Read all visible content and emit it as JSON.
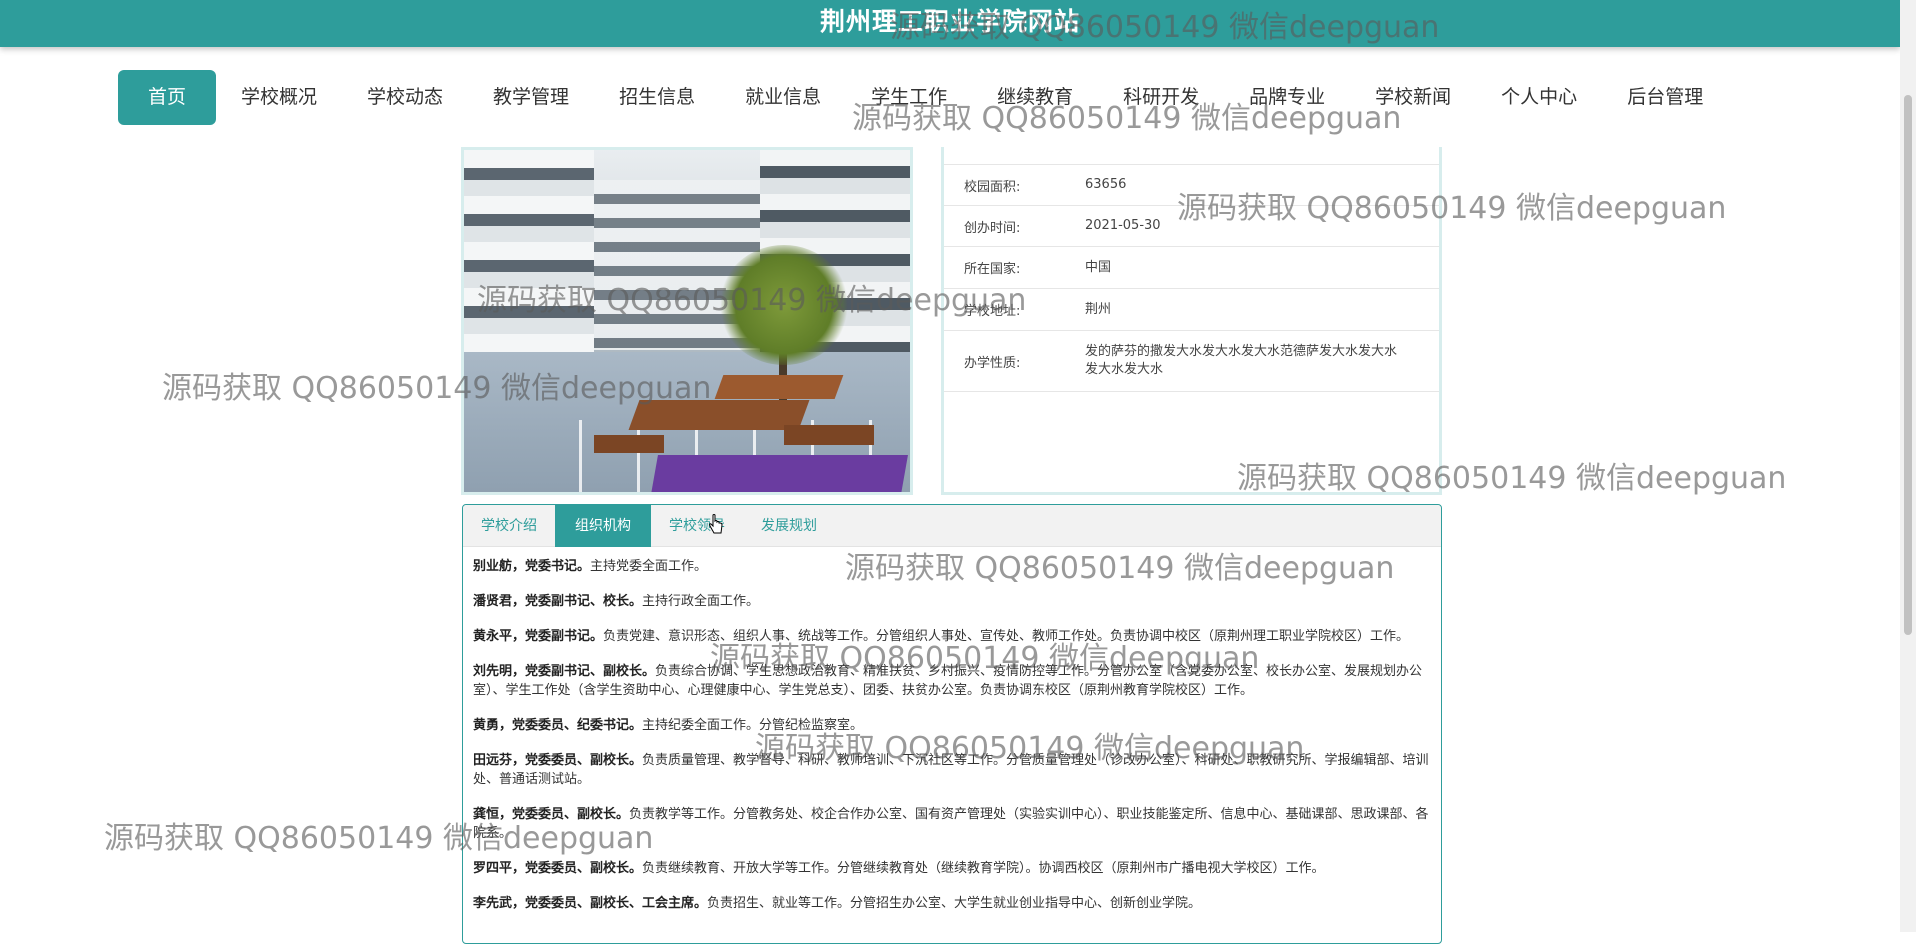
{
  "header": {
    "site_title": "荆州理工职业学院网站"
  },
  "nav": {
    "items": [
      {
        "label": "首页",
        "active": true
      },
      {
        "label": "学校概况"
      },
      {
        "label": "学校动态"
      },
      {
        "label": "教学管理"
      },
      {
        "label": "招生信息"
      },
      {
        "label": "就业信息"
      },
      {
        "label": "学生工作"
      },
      {
        "label": "继续教育"
      },
      {
        "label": "科研开发"
      },
      {
        "label": "品牌专业"
      },
      {
        "label": "学校新闻"
      },
      {
        "label": "个人中心"
      },
      {
        "label": "后台管理"
      }
    ]
  },
  "info": {
    "rows": [
      {
        "label": "校园面积:",
        "value": "63656"
      },
      {
        "label": "创办时间:",
        "value": "2021-05-30"
      },
      {
        "label": "所在国家:",
        "value": "中国"
      },
      {
        "label": "学校地址:",
        "value": "荆州"
      },
      {
        "label": "办学性质:",
        "value": "发的萨芬的撒发大水发大水发大水范德萨发大水发大水发大水发大水"
      }
    ]
  },
  "tabs": {
    "items": [
      {
        "label": "学校介绍"
      },
      {
        "label": "组织机构",
        "active": true
      },
      {
        "label": "学校领导"
      },
      {
        "label": "发展规划"
      }
    ],
    "content": [
      {
        "name": "别业舫，党委书记。",
        "text": "主持党委全面工作。"
      },
      {
        "name": "潘贤君，党委副书记、校长。",
        "text": "主持行政全面工作。"
      },
      {
        "name": "黄永平，党委副书记。",
        "text": "负责党建、意识形态、组织人事、统战等工作。分管组织人事处、宣传处、教师工作处。负责协调中校区（原荆州理工职业学院校区）工作。"
      },
      {
        "name": "刘先明，党委副书记、副校长。",
        "text": "负责综合协调、学生思想政治教育、精准扶贫、乡村振兴、疫情防控等工作。分管办公室（含党委办公室、校长办公室、发展规划办公室）、学生工作处（含学生资助中心、心理健康中心、学生党总支）、团委、扶贫办公室。负责协调东校区（原荆州教育学院校区）工作。"
      },
      {
        "name": "黄勇，党委委员、纪委书记。",
        "text": "主持纪委全面工作。分管纪检监察室。"
      },
      {
        "name": "田远芬，党委委员、副校长。",
        "text": "负责质量管理、教学督导、科研、教师培训、下沉社区等工作。分管质量管理处（诊改办公室）、科研处、职教研究所、学报编辑部、培训处、普通话测试站。"
      },
      {
        "name": "龚恒，党委委员、副校长。",
        "text": "负责教学等工作。分管教务处、校企合作办公室、国有资产管理处（实验实训中心）、职业技能鉴定所、信息中心、基础课部、思政课部、各院系。"
      },
      {
        "name": "罗四平，党委委员、副校长。",
        "text": "负责继续教育、开放大学等工作。分管继续教育处（继续教育学院）。协调西校区（原荆州市广播电视大学校区）工作。"
      },
      {
        "name": "李先武，党委委员、副校长、工会主席。",
        "text": "负责招生、就业等工作。分管招生办公室、大学生就业创业指导中心、创新创业学院。"
      }
    ]
  },
  "watermark": {
    "text": "源码获取 QQ86050149 微信deepguan"
  },
  "colors": {
    "primary": "#2e9d9b"
  }
}
